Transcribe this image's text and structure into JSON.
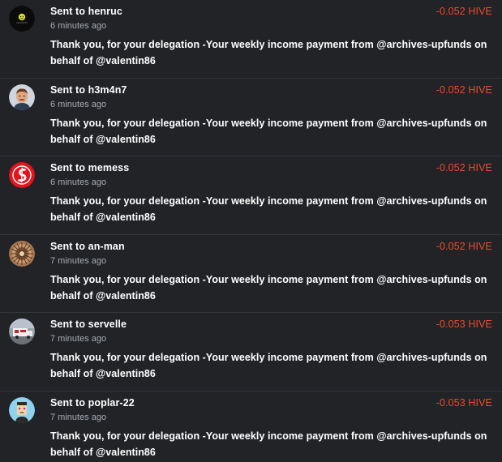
{
  "transfers": [
    {
      "prefix": "Sent to ",
      "user": "henruc",
      "time": "6 minutes ago",
      "amount": "-0.052 HIVE",
      "memo": "Thank you, for your delegation -Your weekly income payment from @archives-upfunds on behalf of @valentin86"
    },
    {
      "prefix": "Sent to ",
      "user": "h3m4n7",
      "time": "6 minutes ago",
      "amount": "-0.052 HIVE",
      "memo": "Thank you, for your delegation -Your weekly income payment from @archives-upfunds on behalf of @valentin86"
    },
    {
      "prefix": "Sent to ",
      "user": "memess",
      "time": "6 minutes ago",
      "amount": "-0.052 HIVE",
      "memo": "Thank you, for your delegation -Your weekly income payment from @archives-upfunds on behalf of @valentin86"
    },
    {
      "prefix": "Sent to ",
      "user": "an-man",
      "time": "7 minutes ago",
      "amount": "-0.052 HIVE",
      "memo": "Thank you, for your delegation -Your weekly income payment from @archives-upfunds on behalf of @valentin86"
    },
    {
      "prefix": "Sent to ",
      "user": "servelle",
      "time": "7 minutes ago",
      "amount": "-0.053 HIVE",
      "memo": "Thank you, for your delegation -Your weekly income payment from @archives-upfunds on behalf of @valentin86"
    },
    {
      "prefix": "Sent to ",
      "user": "poplar-22",
      "time": "7 minutes ago",
      "amount": "-0.053 HIVE",
      "memo": "Thank you, for your delegation -Your weekly income payment from @archives-upfunds on behalf of @valentin86"
    }
  ],
  "colors": {
    "background": "#212327",
    "divider": "#33363b",
    "amount": "#f04a2d",
    "muted": "#a7abb2"
  }
}
